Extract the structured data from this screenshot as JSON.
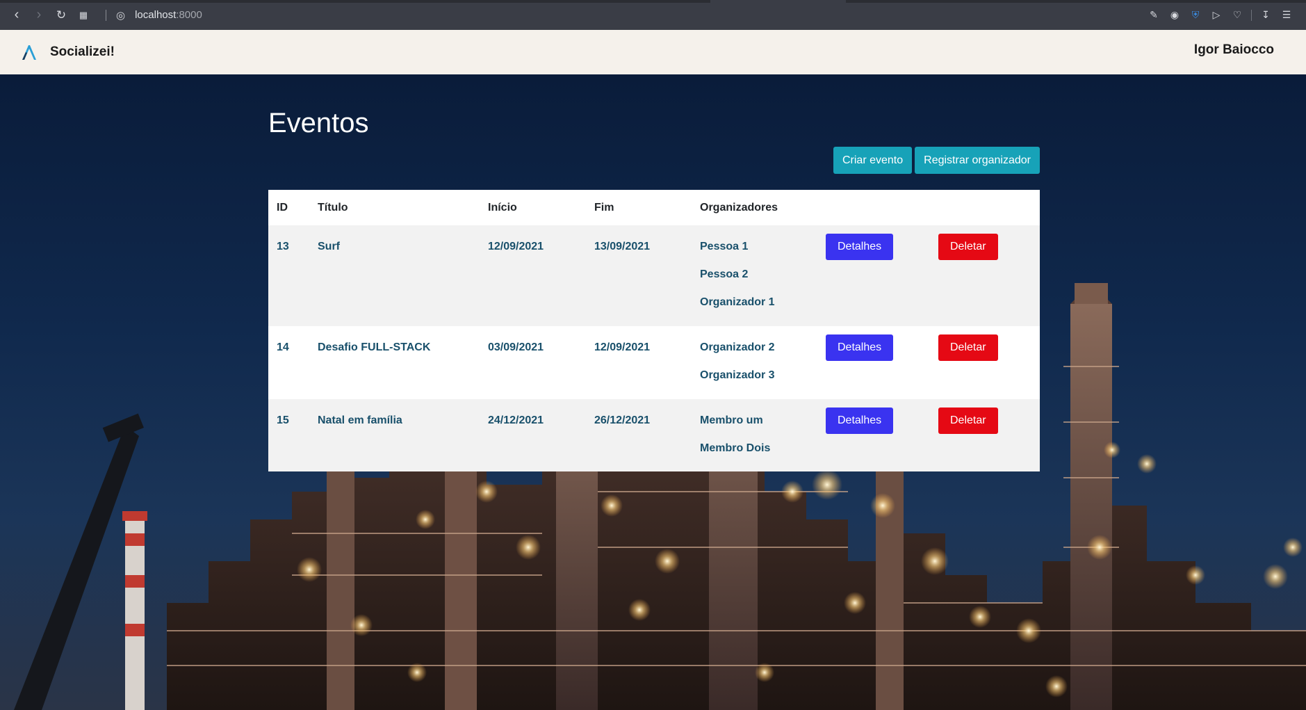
{
  "browser": {
    "url_host": "localhost",
    "url_port": ":8000"
  },
  "navbar": {
    "brand": "Socializei!",
    "user": "Igor Baiocco"
  },
  "page": {
    "title": "Eventos",
    "create_event_label": "Criar evento",
    "register_organizer_label": "Registrar organizador"
  },
  "table": {
    "headers": [
      "ID",
      "Título",
      "Início",
      "Fim",
      "Organizadores"
    ],
    "rows": [
      {
        "id": "13",
        "title": "Surf",
        "start": "12/09/2021",
        "end": "13/09/2021",
        "organizers": [
          "Pessoa 1",
          "Pessoa 2",
          "Organizador 1"
        ],
        "details_label": "Detalhes",
        "delete_label": "Deletar"
      },
      {
        "id": "14",
        "title": "Desafio FULL-STACK",
        "start": "03/09/2021",
        "end": "12/09/2021",
        "organizers": [
          "Organizador 2",
          "Organizador 3"
        ],
        "details_label": "Detalhes",
        "delete_label": "Deletar"
      },
      {
        "id": "15",
        "title": "Natal em família",
        "start": "24/12/2021",
        "end": "26/12/2021",
        "organizers": [
          "Membro um",
          "Membro Dois"
        ],
        "details_label": "Detalhes",
        "delete_label": "Deletar"
      }
    ]
  },
  "colors": {
    "info": "#17a2b8",
    "primary": "#3a33f0",
    "danger": "#e50914",
    "cell_text": "#19506b",
    "navbar_bg": "#f5f1eb"
  }
}
